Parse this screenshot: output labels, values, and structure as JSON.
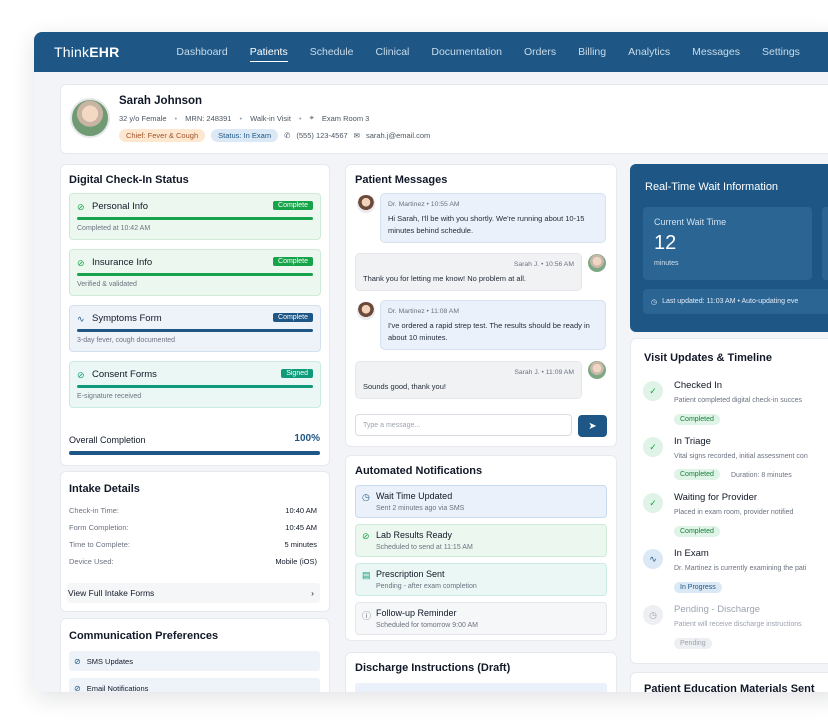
{
  "app": {
    "logo_prefix": "Think",
    "logo_suffix": "EHR"
  },
  "nav": [
    "Dashboard",
    "Patients",
    "Schedule",
    "Clinical",
    "Documentation",
    "Orders",
    "Billing",
    "Analytics",
    "Messages",
    "Settings"
  ],
  "nav_active": "Patients",
  "patient": {
    "name": "Sarah Johnson",
    "age_sex": "32 y/o Female",
    "mrn": "MRN: 248391",
    "visit_type": "Walk-in Visit",
    "room": "Exam Room 3",
    "chief": "Chief: Fever & Cough",
    "status": "Status: In Exam",
    "phone": "(555) 123-4567",
    "email": "sarah.j@email.com"
  },
  "checkin": {
    "title": "Digital Check-In Status",
    "items": [
      {
        "name": "Personal Info",
        "badge": "Complete",
        "sub": "Completed at 10:42 AM"
      },
      {
        "name": "Insurance Info",
        "badge": "Complete",
        "sub": "Verified & validated"
      },
      {
        "name": "Symptoms Form",
        "badge": "Complete",
        "sub": "3-day fever, cough documented"
      },
      {
        "name": "Consent Forms",
        "badge": "Signed",
        "sub": "E-signature received"
      }
    ],
    "overall_label": "Overall Completion",
    "overall_value": "100%",
    "overall_progress": 1.0
  },
  "intake": {
    "title": "Intake Details",
    "rows": [
      {
        "k": "Check-in Time:",
        "v": "10:40 AM"
      },
      {
        "k": "Form Completion:",
        "v": "10:45 AM"
      },
      {
        "k": "Time to Complete:",
        "v": "5 minutes"
      },
      {
        "k": "Device Used:",
        "v": "Mobile (iOS)"
      }
    ],
    "link": "View Full Intake Forms"
  },
  "prefs": {
    "title": "Communication Preferences",
    "items": [
      "SMS Updates",
      "Email Notifications"
    ]
  },
  "messages": {
    "title": "Patient Messages",
    "items": [
      {
        "from": "doctor",
        "meta": "Dr. Martinez • 10:55 AM",
        "text": "Hi Sarah, I'll be with you shortly. We're running about 10-15 minutes behind schedule."
      },
      {
        "from": "patient",
        "meta": "Sarah J. • 10:56 AM",
        "text": "Thank you for letting me know! No problem at all."
      },
      {
        "from": "doctor",
        "meta": "Dr. Martinez • 11:08 AM",
        "text": "I've ordered a rapid strep test. The results should be ready in about 10 minutes."
      },
      {
        "from": "patient",
        "meta": "Sarah J. • 11:09 AM",
        "text": "Sounds good, thank you!"
      }
    ],
    "input_placeholder": "Type a message..."
  },
  "notifications": {
    "title": "Automated Notifications",
    "items": [
      {
        "title": "Wait Time Updated",
        "sub": "Sent 2 minutes ago via SMS"
      },
      {
        "title": "Lab Results Ready",
        "sub": "Scheduled to send at 11:15 AM"
      },
      {
        "title": "Prescription Sent",
        "sub": "Pending - after exam completion"
      },
      {
        "title": "Follow-up Reminder",
        "sub": "Scheduled for tomorrow 9:00 AM"
      }
    ]
  },
  "discharge": {
    "title": "Discharge Instructions (Draft)"
  },
  "wait": {
    "title": "Real-Time Wait Information",
    "label": "Current Wait Time",
    "value": "12",
    "unit": "minutes",
    "updated": "Last updated: 11:03 AM • Auto-updating eve"
  },
  "timeline": {
    "title": "Visit Updates & Timeline",
    "items": [
      {
        "name": "Checked In",
        "sub": "Patient completed digital check-in succes",
        "badge": "Completed",
        "extra": ""
      },
      {
        "name": "In Triage",
        "sub": "Vital signs recorded, initial assessment con",
        "badge": "Completed",
        "extra": "Duration: 8 minutes"
      },
      {
        "name": "Waiting for Provider",
        "sub": "Placed in exam room, provider notified",
        "badge": "Completed",
        "extra": ""
      },
      {
        "name": "In Exam",
        "sub": "Dr. Martinez is currently examining the pati",
        "badge": "In Progress",
        "extra": ""
      },
      {
        "name": "Pending - Discharge",
        "sub": "Patient will receive discharge instructions",
        "badge": "Pending",
        "extra": ""
      }
    ]
  },
  "education": {
    "title": "Patient Education Materials Sent"
  },
  "colors": {
    "brand": "#1e5785",
    "success": "#16a34a",
    "teal": "#0f9b7a",
    "chief_tag": "#fde8cf"
  }
}
